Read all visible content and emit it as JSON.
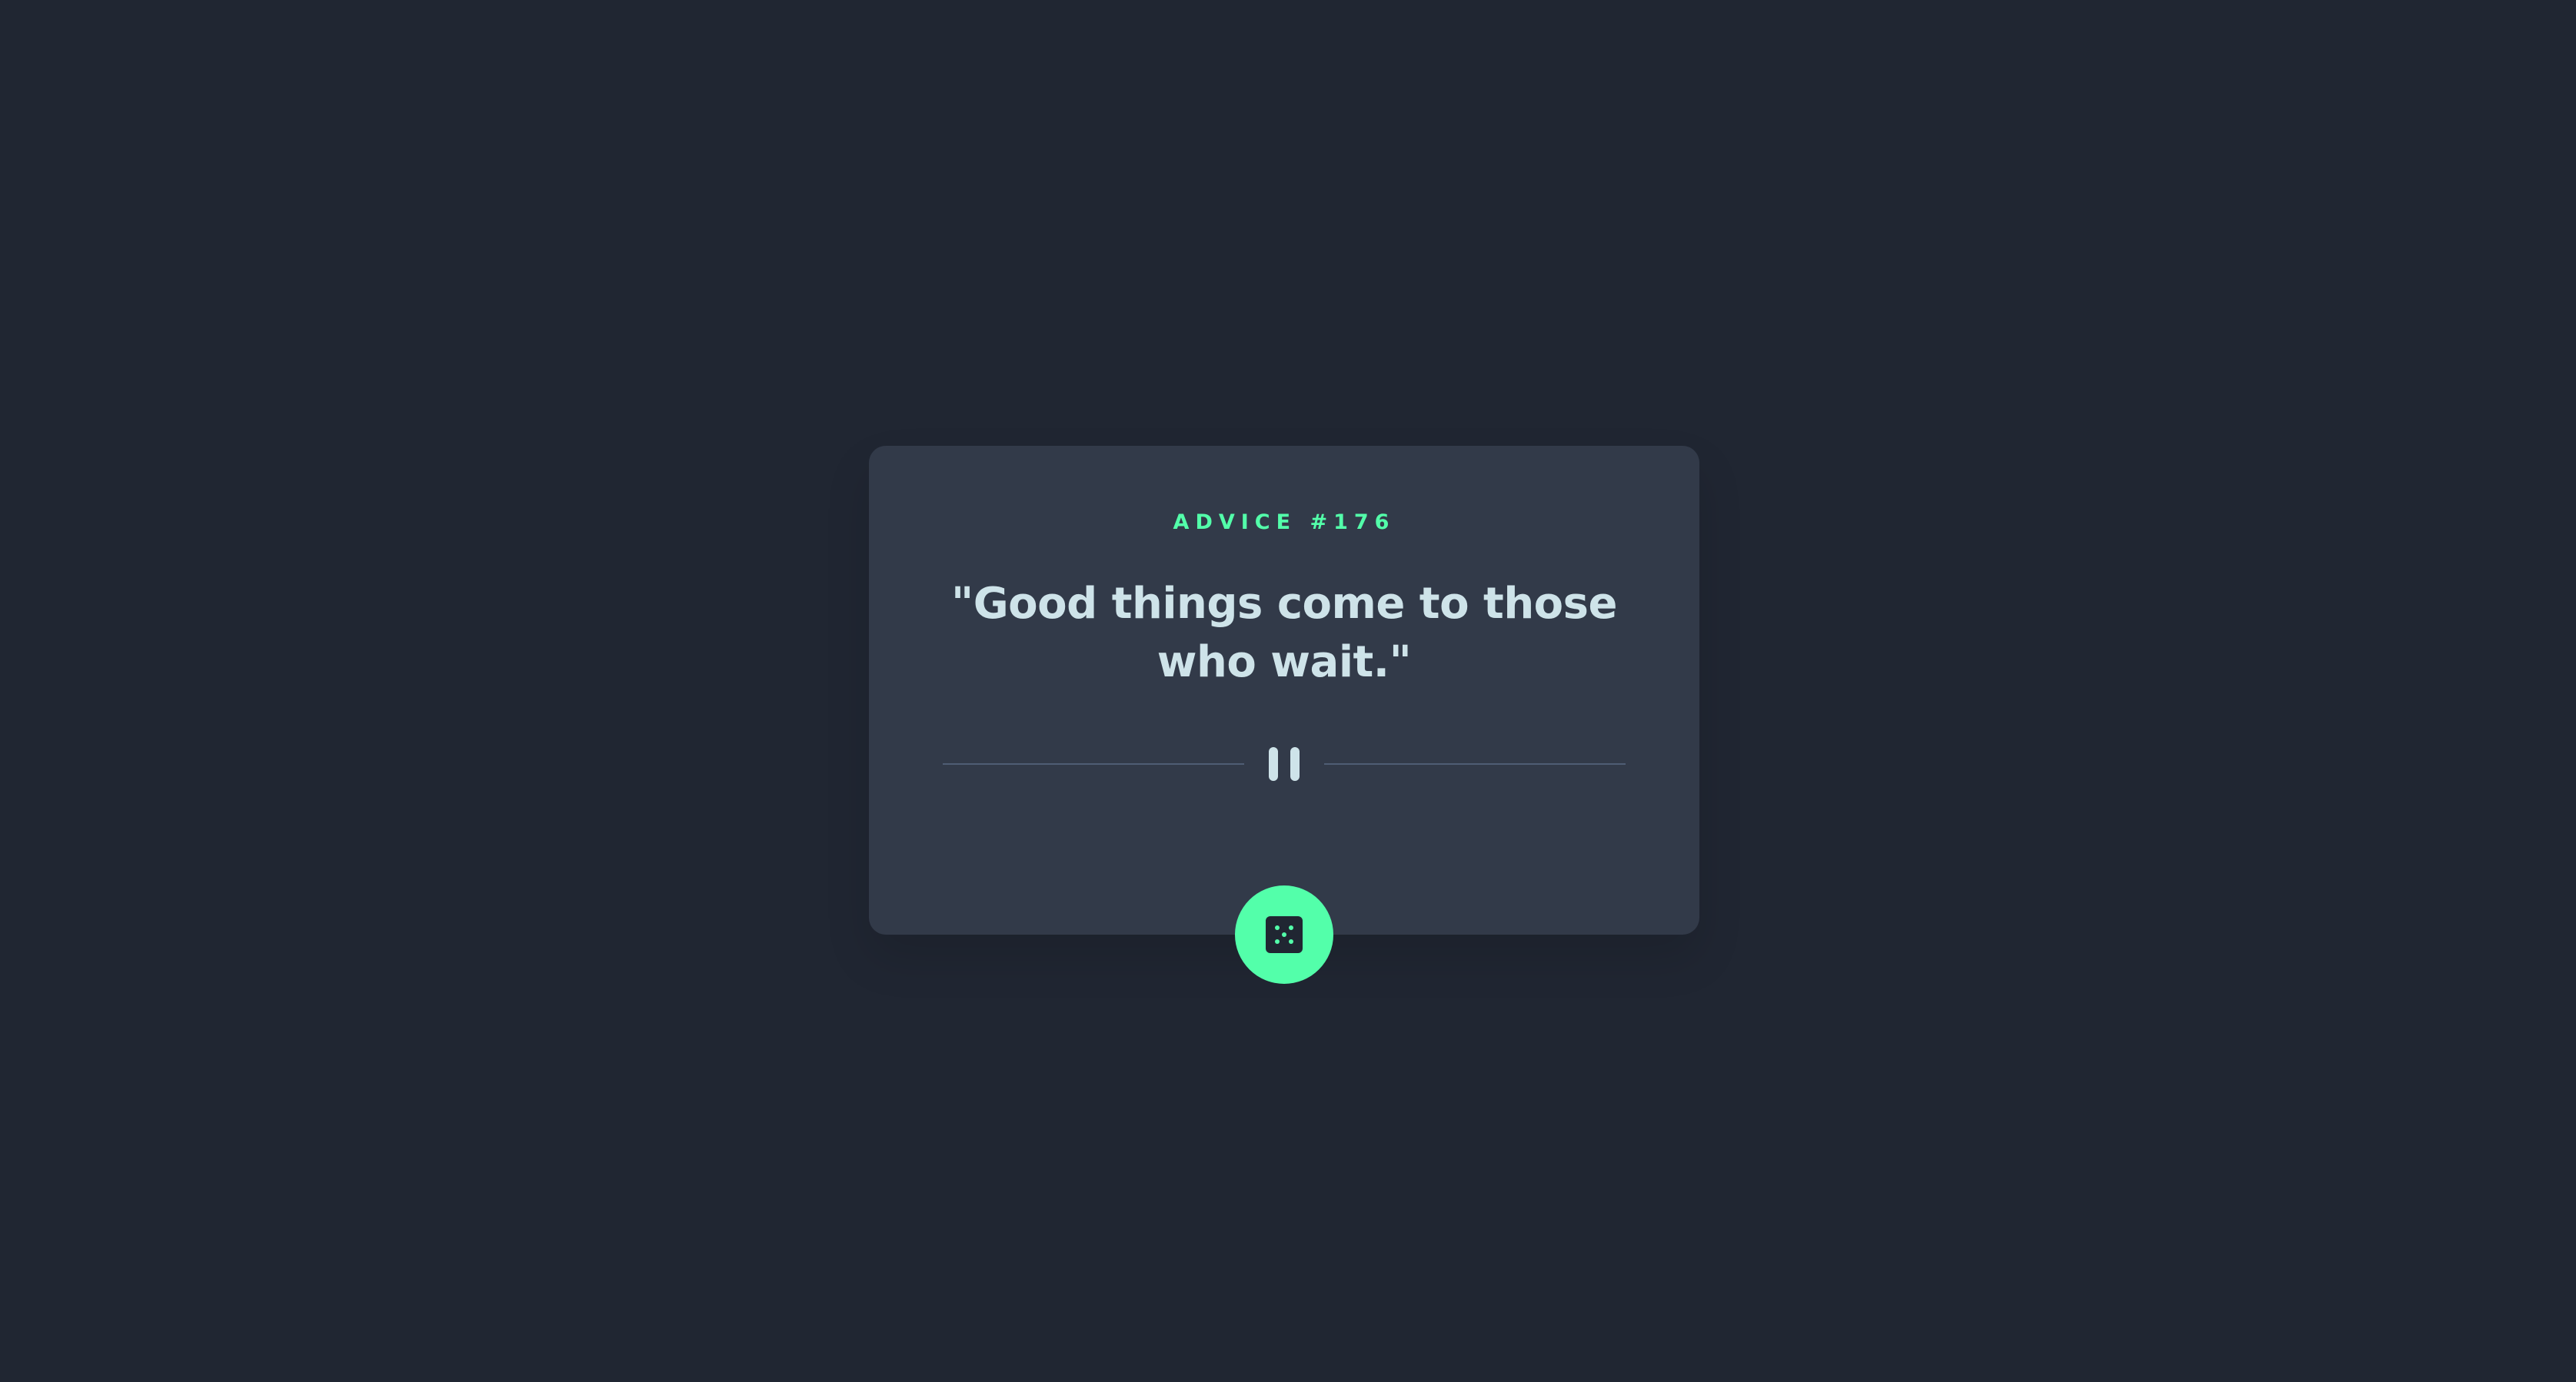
{
  "card": {
    "advice_label": "ADVICE #176",
    "quote": "\"Good things come to those who wait.\""
  },
  "divider": {
    "icon": "pause-quote-divider-icon"
  },
  "dice_button": {
    "icon": "dice-icon"
  },
  "colors": {
    "background": "#202632",
    "card": "#323a49",
    "accent": "#53ffaa",
    "text": "#cee3e9",
    "divider_line": "#4f5d74"
  }
}
